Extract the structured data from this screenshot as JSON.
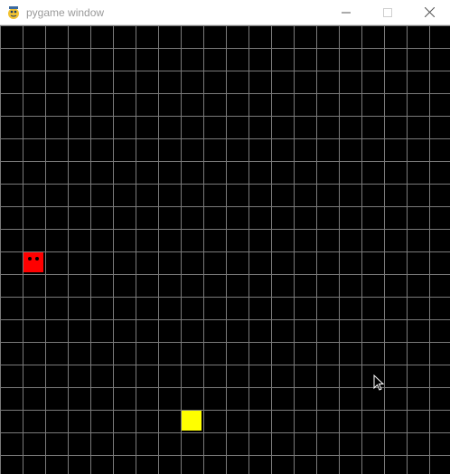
{
  "window": {
    "title": "pygame window",
    "controls": [
      "minimize",
      "maximize",
      "close"
    ]
  },
  "icons": {
    "app": "pygame-snake-icon",
    "minimize": "minimize-icon",
    "maximize": "maximize-icon",
    "close": "close-icon"
  },
  "game": {
    "grid": {
      "cell_count": "20x20",
      "line_color": "#7a7a7a"
    },
    "background_color": "#000000",
    "snake": {
      "color": "#ff0000",
      "eye_color": "#000000",
      "head_cell": [
        1,
        10
      ]
    },
    "food": {
      "color": "#ffff00",
      "cell": [
        8,
        17
      ]
    }
  }
}
